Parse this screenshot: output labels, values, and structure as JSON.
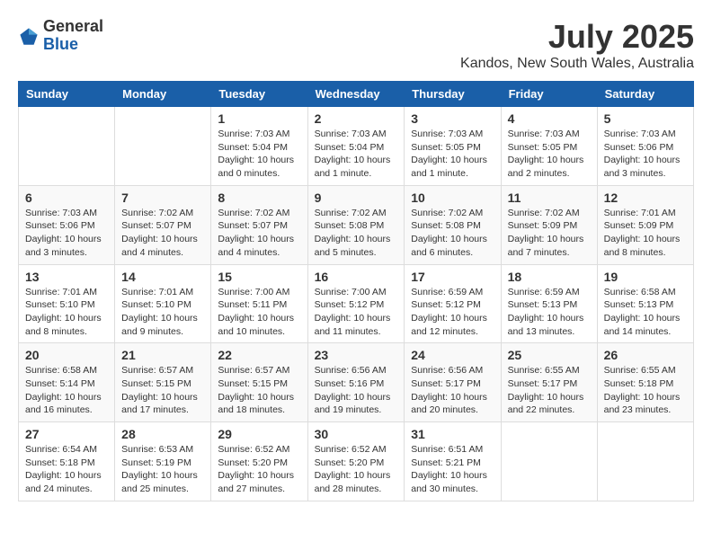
{
  "header": {
    "logo": {
      "line1": "General",
      "line2": "Blue"
    },
    "month": "July 2025",
    "location": "Kandos, New South Wales, Australia"
  },
  "weekdays": [
    "Sunday",
    "Monday",
    "Tuesday",
    "Wednesday",
    "Thursday",
    "Friday",
    "Saturday"
  ],
  "weeks": [
    [
      {
        "day": "",
        "sunrise": "",
        "sunset": "",
        "daylight": ""
      },
      {
        "day": "",
        "sunrise": "",
        "sunset": "",
        "daylight": ""
      },
      {
        "day": "1",
        "sunrise": "Sunrise: 7:03 AM",
        "sunset": "Sunset: 5:04 PM",
        "daylight": "Daylight: 10 hours and 0 minutes."
      },
      {
        "day": "2",
        "sunrise": "Sunrise: 7:03 AM",
        "sunset": "Sunset: 5:04 PM",
        "daylight": "Daylight: 10 hours and 1 minute."
      },
      {
        "day": "3",
        "sunrise": "Sunrise: 7:03 AM",
        "sunset": "Sunset: 5:05 PM",
        "daylight": "Daylight: 10 hours and 1 minute."
      },
      {
        "day": "4",
        "sunrise": "Sunrise: 7:03 AM",
        "sunset": "Sunset: 5:05 PM",
        "daylight": "Daylight: 10 hours and 2 minutes."
      },
      {
        "day": "5",
        "sunrise": "Sunrise: 7:03 AM",
        "sunset": "Sunset: 5:06 PM",
        "daylight": "Daylight: 10 hours and 3 minutes."
      }
    ],
    [
      {
        "day": "6",
        "sunrise": "Sunrise: 7:03 AM",
        "sunset": "Sunset: 5:06 PM",
        "daylight": "Daylight: 10 hours and 3 minutes."
      },
      {
        "day": "7",
        "sunrise": "Sunrise: 7:02 AM",
        "sunset": "Sunset: 5:07 PM",
        "daylight": "Daylight: 10 hours and 4 minutes."
      },
      {
        "day": "8",
        "sunrise": "Sunrise: 7:02 AM",
        "sunset": "Sunset: 5:07 PM",
        "daylight": "Daylight: 10 hours and 4 minutes."
      },
      {
        "day": "9",
        "sunrise": "Sunrise: 7:02 AM",
        "sunset": "Sunset: 5:08 PM",
        "daylight": "Daylight: 10 hours and 5 minutes."
      },
      {
        "day": "10",
        "sunrise": "Sunrise: 7:02 AM",
        "sunset": "Sunset: 5:08 PM",
        "daylight": "Daylight: 10 hours and 6 minutes."
      },
      {
        "day": "11",
        "sunrise": "Sunrise: 7:02 AM",
        "sunset": "Sunset: 5:09 PM",
        "daylight": "Daylight: 10 hours and 7 minutes."
      },
      {
        "day": "12",
        "sunrise": "Sunrise: 7:01 AM",
        "sunset": "Sunset: 5:09 PM",
        "daylight": "Daylight: 10 hours and 8 minutes."
      }
    ],
    [
      {
        "day": "13",
        "sunrise": "Sunrise: 7:01 AM",
        "sunset": "Sunset: 5:10 PM",
        "daylight": "Daylight: 10 hours and 8 minutes."
      },
      {
        "day": "14",
        "sunrise": "Sunrise: 7:01 AM",
        "sunset": "Sunset: 5:10 PM",
        "daylight": "Daylight: 10 hours and 9 minutes."
      },
      {
        "day": "15",
        "sunrise": "Sunrise: 7:00 AM",
        "sunset": "Sunset: 5:11 PM",
        "daylight": "Daylight: 10 hours and 10 minutes."
      },
      {
        "day": "16",
        "sunrise": "Sunrise: 7:00 AM",
        "sunset": "Sunset: 5:12 PM",
        "daylight": "Daylight: 10 hours and 11 minutes."
      },
      {
        "day": "17",
        "sunrise": "Sunrise: 6:59 AM",
        "sunset": "Sunset: 5:12 PM",
        "daylight": "Daylight: 10 hours and 12 minutes."
      },
      {
        "day": "18",
        "sunrise": "Sunrise: 6:59 AM",
        "sunset": "Sunset: 5:13 PM",
        "daylight": "Daylight: 10 hours and 13 minutes."
      },
      {
        "day": "19",
        "sunrise": "Sunrise: 6:58 AM",
        "sunset": "Sunset: 5:13 PM",
        "daylight": "Daylight: 10 hours and 14 minutes."
      }
    ],
    [
      {
        "day": "20",
        "sunrise": "Sunrise: 6:58 AM",
        "sunset": "Sunset: 5:14 PM",
        "daylight": "Daylight: 10 hours and 16 minutes."
      },
      {
        "day": "21",
        "sunrise": "Sunrise: 6:57 AM",
        "sunset": "Sunset: 5:15 PM",
        "daylight": "Daylight: 10 hours and 17 minutes."
      },
      {
        "day": "22",
        "sunrise": "Sunrise: 6:57 AM",
        "sunset": "Sunset: 5:15 PM",
        "daylight": "Daylight: 10 hours and 18 minutes."
      },
      {
        "day": "23",
        "sunrise": "Sunrise: 6:56 AM",
        "sunset": "Sunset: 5:16 PM",
        "daylight": "Daylight: 10 hours and 19 minutes."
      },
      {
        "day": "24",
        "sunrise": "Sunrise: 6:56 AM",
        "sunset": "Sunset: 5:17 PM",
        "daylight": "Daylight: 10 hours and 20 minutes."
      },
      {
        "day": "25",
        "sunrise": "Sunrise: 6:55 AM",
        "sunset": "Sunset: 5:17 PM",
        "daylight": "Daylight: 10 hours and 22 minutes."
      },
      {
        "day": "26",
        "sunrise": "Sunrise: 6:55 AM",
        "sunset": "Sunset: 5:18 PM",
        "daylight": "Daylight: 10 hours and 23 minutes."
      }
    ],
    [
      {
        "day": "27",
        "sunrise": "Sunrise: 6:54 AM",
        "sunset": "Sunset: 5:18 PM",
        "daylight": "Daylight: 10 hours and 24 minutes."
      },
      {
        "day": "28",
        "sunrise": "Sunrise: 6:53 AM",
        "sunset": "Sunset: 5:19 PM",
        "daylight": "Daylight: 10 hours and 25 minutes."
      },
      {
        "day": "29",
        "sunrise": "Sunrise: 6:52 AM",
        "sunset": "Sunset: 5:20 PM",
        "daylight": "Daylight: 10 hours and 27 minutes."
      },
      {
        "day": "30",
        "sunrise": "Sunrise: 6:52 AM",
        "sunset": "Sunset: 5:20 PM",
        "daylight": "Daylight: 10 hours and 28 minutes."
      },
      {
        "day": "31",
        "sunrise": "Sunrise: 6:51 AM",
        "sunset": "Sunset: 5:21 PM",
        "daylight": "Daylight: 10 hours and 30 minutes."
      },
      {
        "day": "",
        "sunrise": "",
        "sunset": "",
        "daylight": ""
      },
      {
        "day": "",
        "sunrise": "",
        "sunset": "",
        "daylight": ""
      }
    ]
  ]
}
